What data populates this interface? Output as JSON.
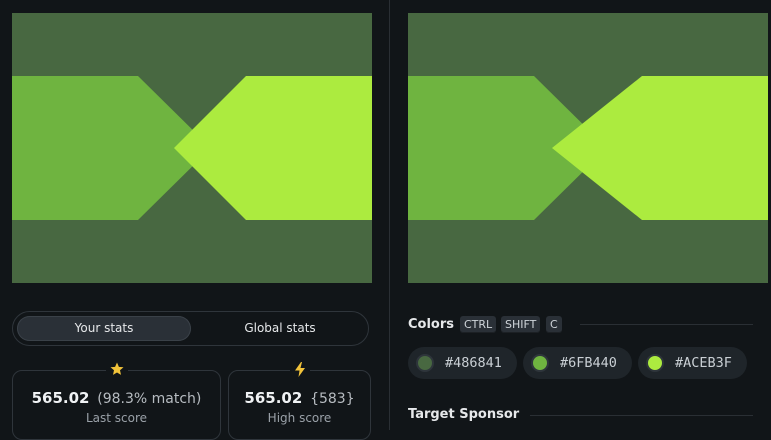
{
  "colors": {
    "bg": "#486841",
    "mid": "#6FB440",
    "light": "#ACEB3F",
    "page_bg": "#111518"
  },
  "stats": {
    "tabs": [
      "Your stats",
      "Global stats"
    ],
    "last": {
      "value": "565.02",
      "extra": "(98.3% match)",
      "label": "Last score",
      "icon": "star-icon"
    },
    "high": {
      "value": "565.02",
      "extra": "{583}",
      "label": "High score",
      "icon": "lightning-icon"
    }
  },
  "colors_section": {
    "title": "Colors",
    "shortcut": [
      "CTRL",
      "SHIFT",
      "C"
    ],
    "swatches": [
      {
        "hex": "#486841"
      },
      {
        "hex": "#6FB440"
      },
      {
        "hex": "#ACEB3F"
      }
    ]
  },
  "sponsor_section": {
    "title": "Target Sponsor"
  }
}
